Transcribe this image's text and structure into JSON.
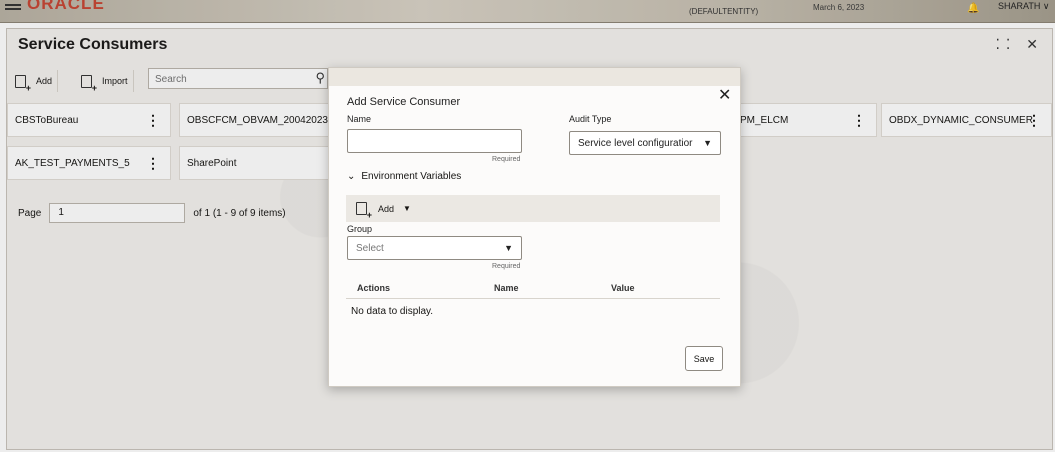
{
  "header": {
    "logo": "ORACLE",
    "entity": "(DEFAULTENTITY)",
    "date": "March 6, 2023",
    "user": "SHARATH",
    "user_chevron": "∨"
  },
  "page": {
    "title": "Service Consumers",
    "window_controls": "⁚⁚ ✕"
  },
  "toolbar": {
    "add_label": "Add",
    "import_label": "Import",
    "search_placeholder": "Search"
  },
  "consumers": [
    "CBSToBureau",
    "OBSCFCM_OBVAM_20042023",
    "PM_ELCM",
    "OBDX_DYNAMIC_CONSUMER",
    "AK_TEST_PAYMENTS_5",
    "SharePoint"
  ],
  "pager": {
    "label": "Page",
    "value": "1",
    "summary": "of 1  (1 - 9 of 9 items)"
  },
  "modal": {
    "title": "Add Service Consumer",
    "name_label": "Name",
    "name_value": "",
    "name_required": "Required",
    "audit_label": "Audit Type",
    "audit_value": "Service level configuratior",
    "env_label": "Environment Variables",
    "add_label": "Add",
    "group_label": "Group",
    "group_placeholder": "Select",
    "group_required": "Required",
    "columns": [
      "Actions",
      "Name",
      "Value"
    ],
    "empty_text": "No data to display.",
    "save_label": "Save"
  }
}
